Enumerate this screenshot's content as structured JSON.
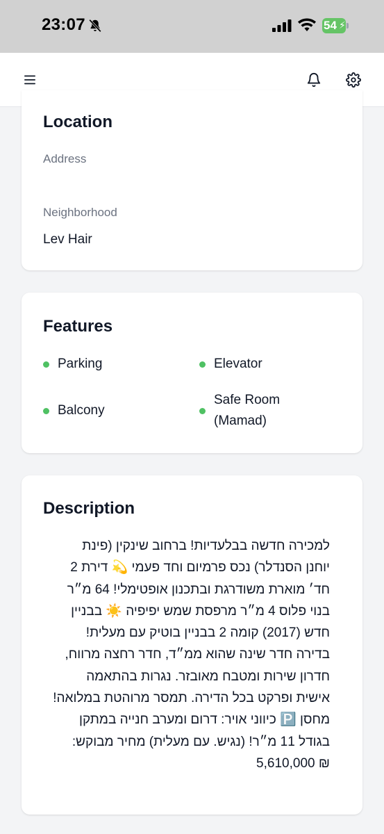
{
  "status_bar": {
    "time": "23:07",
    "battery_level": "54",
    "battery_color": "#65c466"
  },
  "header": {
    "icons": [
      "menu-icon",
      "bell-icon",
      "gear-icon"
    ]
  },
  "location": {
    "title": "Location",
    "address_label": "Address",
    "address_value": "",
    "neighborhood_label": "Neighborhood",
    "neighborhood_value": "Lev Hair"
  },
  "features": {
    "title": "Features",
    "dot_color": "#4fc163",
    "items": [
      "Parking",
      "Elevator",
      "Balcony",
      "Safe Room\n(Mamad)"
    ]
  },
  "description": {
    "title": "Description",
    "text": "למכירה חדשה בבלעדיות! ברחוב שינקין (פינת\nיוחנן הסנדלר) נכס פרמיום וחד פעמי 💫 דירת 2\nחד׳ מוארת משודרגת ובתכנון אופטימלי! 64 מ״ר\nבנוי פלוס 4 מ״ר מרפסת שמש יפיפיה ☀️ בבניין\nחדש (2017) קומה 2 בבניין בוטיק עם מעלית!\nבדירה חדר שינה שהוא ממ״ד, חדר רחצה מרווח,\nחדרון שירות ומטבח מאובזר. נגרות בהתאמה\nאישית ופרקט בכל הדירה. תמסר מרוהטת במלואה!\nמחסן 🅿️ כיווני אויר: דרום ומערב חנייה במתקן\nבגודל 11 מ״ר! (נגיש. עם מעלית) מחיר מבוקש:\n₪ 5,610,000"
  }
}
